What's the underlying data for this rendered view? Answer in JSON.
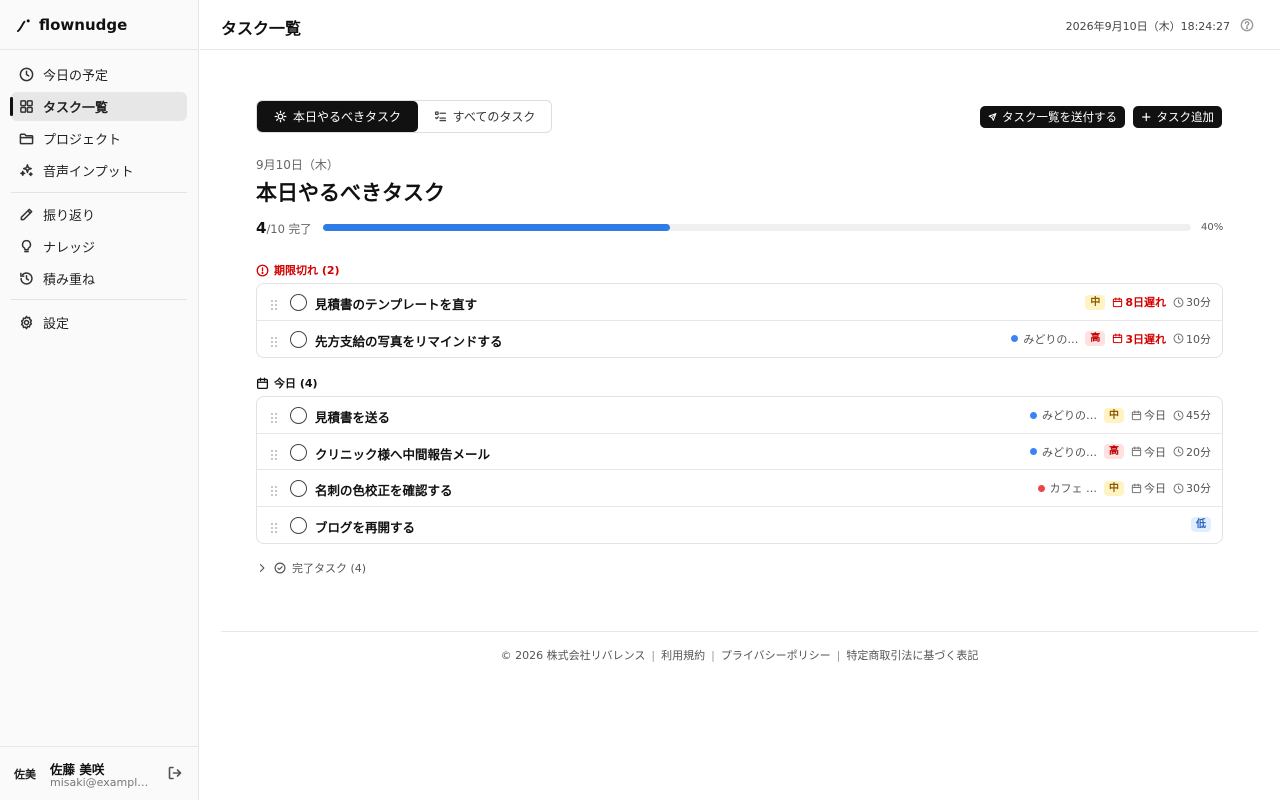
{
  "app": {
    "name": "flownudge"
  },
  "sidebar": {
    "items": [
      {
        "label": "今日の予定",
        "icon": "clock-icon"
      },
      {
        "label": "タスク一覧",
        "icon": "grid-icon"
      },
      {
        "label": "プロジェクト",
        "icon": "folder-icon"
      },
      {
        "label": "音声インプット",
        "icon": "sparkle-icon"
      },
      {
        "label": "振り返り",
        "icon": "pencil-icon"
      },
      {
        "label": "ナレッジ",
        "icon": "lightbulb-icon"
      },
      {
        "label": "積み重ね",
        "icon": "history-icon"
      },
      {
        "label": "設定",
        "icon": "gear-icon"
      }
    ],
    "active_label": "タスク一覧"
  },
  "user": {
    "initials": "佐美",
    "name": "佐藤 美咲",
    "email": "misaki@example.com"
  },
  "header": {
    "title": "タスク一覧",
    "datetime": "2026年9月10日（木）18:24:27"
  },
  "tabs": [
    {
      "label": "本日やるべきタスク",
      "active": true
    },
    {
      "label": "すべてのタスク",
      "active": false
    }
  ],
  "actions": {
    "send_label": "タスク一覧を送付する",
    "add_label": "タスク追加"
  },
  "main": {
    "date_label": "9月10日（木）",
    "title": "本日やるべきタスク",
    "progress": {
      "done": "4",
      "total_text": "/10 完了",
      "percent": 40,
      "percent_label": "40%"
    }
  },
  "groups": {
    "overdue": {
      "label": "期限切れ (2)",
      "tasks": [
        {
          "title": "見積書のテンプレートを直す",
          "project": "",
          "project_color": "",
          "priority": "中",
          "priority_level": "mid",
          "due": "8日遅れ",
          "due_late": true,
          "duration": "30分"
        },
        {
          "title": "先方支給の写真をリマインドする",
          "project": "みどりの…",
          "project_color": "#3b82f6",
          "priority": "高",
          "priority_level": "high",
          "due": "3日遅れ",
          "due_late": true,
          "duration": "10分"
        }
      ]
    },
    "today": {
      "label": "今日 (4)",
      "tasks": [
        {
          "title": "見積書を送る",
          "project": "みどりの…",
          "project_color": "#3b82f6",
          "priority": "中",
          "priority_level": "mid",
          "due": "今日",
          "due_late": false,
          "duration": "45分"
        },
        {
          "title": "クリニック様へ中間報告メール",
          "project": "みどりの…",
          "project_color": "#3b82f6",
          "priority": "高",
          "priority_level": "high",
          "due": "今日",
          "due_late": false,
          "duration": "20分"
        },
        {
          "title": "名刺の色校正を確認する",
          "project": "カフェ …",
          "project_color": "#ef4444",
          "priority": "中",
          "priority_level": "mid",
          "due": "今日",
          "due_late": false,
          "duration": "30分"
        },
        {
          "title": "ブログを再開する",
          "project": "",
          "project_color": "",
          "priority": "低",
          "priority_level": "low",
          "due": "",
          "due_late": false,
          "duration": ""
        }
      ]
    }
  },
  "completed": {
    "label": "完了タスク (4)"
  },
  "footer": {
    "copyright": "© 2026 株式会社リバレンス",
    "links": [
      "利用規約",
      "プライバシーポリシー",
      "特定商取引法に基づく表記"
    ]
  }
}
